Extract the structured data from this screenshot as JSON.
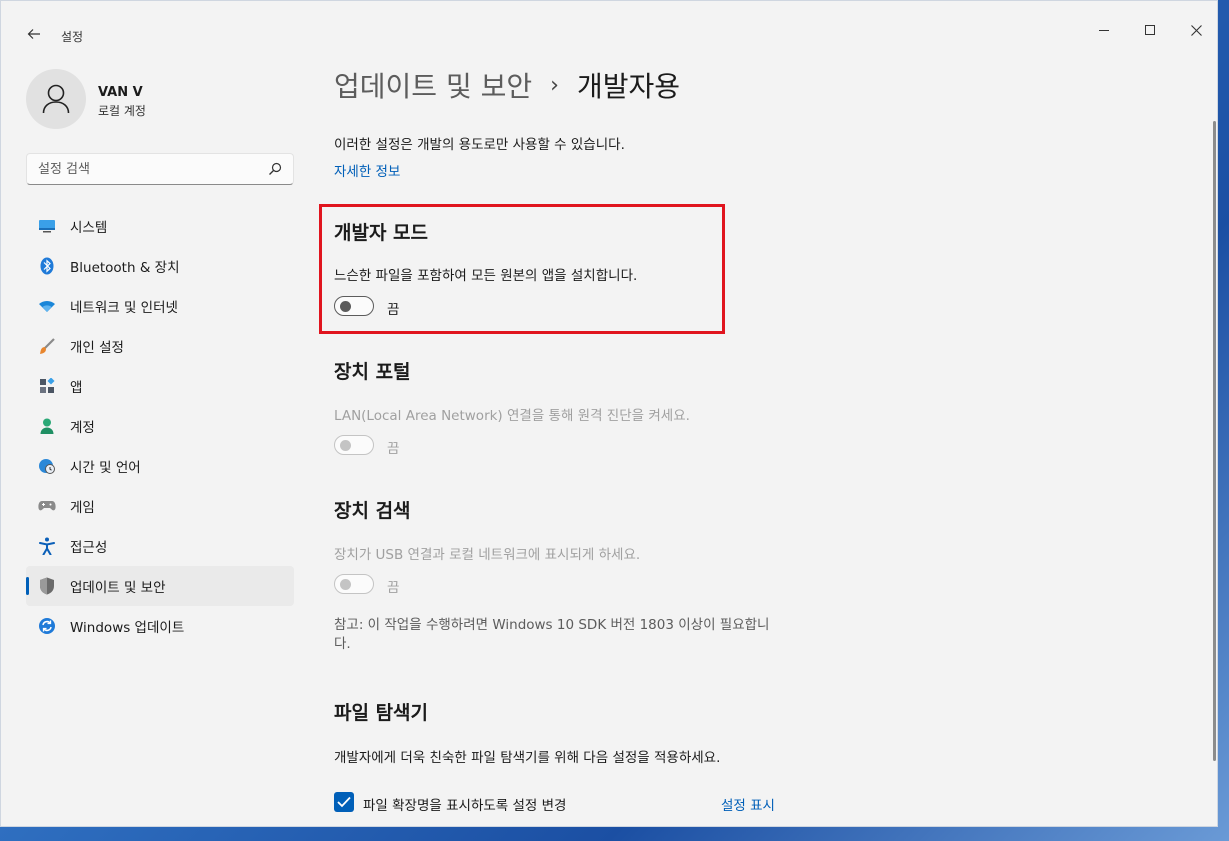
{
  "window": {
    "app_title": "설정",
    "back_icon": "arrow-left-icon"
  },
  "user": {
    "name": "VAN V",
    "account_type": "로컬 계정"
  },
  "search": {
    "placeholder": "설정 검색"
  },
  "sidebar": {
    "items": [
      {
        "label": "시스템",
        "icon": "monitor-icon",
        "color": "#0078d4"
      },
      {
        "label": "Bluetooth & 장치",
        "icon": "bluetooth-icon",
        "color": "#0078d4"
      },
      {
        "label": "네트워크 및 인터넷",
        "icon": "wifi-icon",
        "color": "#0078d4"
      },
      {
        "label": "개인 설정",
        "icon": "brush-icon",
        "color": "#e07a2e"
      },
      {
        "label": "앱",
        "icon": "apps-icon",
        "color": "#4a5a6a"
      },
      {
        "label": "계정",
        "icon": "person-icon",
        "color": "#2aa876"
      },
      {
        "label": "시간 및 언어",
        "icon": "globe-clock-icon",
        "color": "#0078d4"
      },
      {
        "label": "게임",
        "icon": "gamepad-icon",
        "color": "#7a7a7a"
      },
      {
        "label": "접근성",
        "icon": "accessibility-icon",
        "color": "#0a5fb8"
      },
      {
        "label": "업데이트 및 보안",
        "icon": "shield-icon",
        "color": "#6b6b6b",
        "active": true
      },
      {
        "label": "Windows 업데이트",
        "icon": "refresh-icon",
        "color": "#0078d4"
      }
    ]
  },
  "main": {
    "breadcrumb_parent": "업데이트 및 보안",
    "breadcrumb_sep": "›",
    "breadcrumb_current": "개발자용",
    "intro": "이러한 설정은 개발의 용도로만 사용할 수 있습니다.",
    "more_info": "자세한 정보",
    "dev_mode": {
      "title": "개발자 모드",
      "desc": "느슨한 파일을 포함하여 모든 원본의 앱을 설치합니다.",
      "state": "끔"
    },
    "device_portal": {
      "title": "장치 포털",
      "desc": "LAN(Local Area Network) 연결을 통해 원격 진단을 켜세요.",
      "state": "끔"
    },
    "device_discovery": {
      "title": "장치 검색",
      "desc": "장치가 USB 연결과 로컬 네트워크에 표시되게 하세요.",
      "state": "끔",
      "note": "참고: 이 작업을 수행하려면 Windows 10 SDK 버전 1803 이상이 필요합니다."
    },
    "file_explorer": {
      "title": "파일 탐색기",
      "desc": "개발자에게 더욱 친숙한 파일 탐색기를 위해 다음 설정을 적용하세요.",
      "checkbox_label": "파일 확장명을 표시하도록 설정 변경",
      "show_settings": "설정 표시"
    }
  },
  "colors": {
    "accent": "#005fb8",
    "highlight_border": "#e0141e"
  }
}
